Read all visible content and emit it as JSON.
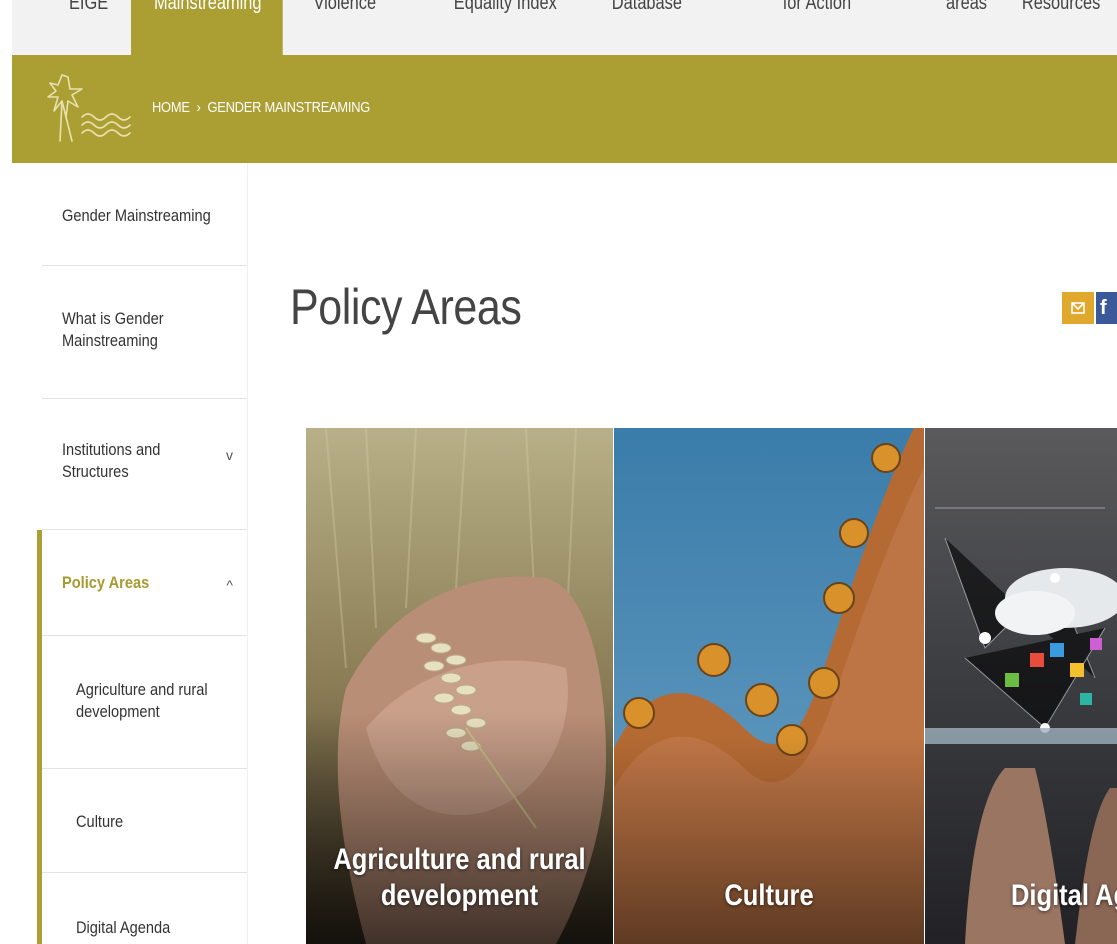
{
  "topnav": {
    "items": [
      {
        "label": "EIGE"
      },
      {
        "label": "Mainstreaming"
      },
      {
        "label": "Violence"
      },
      {
        "label": "Equality Index"
      },
      {
        "label": "Database"
      },
      {
        "label": "for Action"
      },
      {
        "label": "areas"
      },
      {
        "label": "Resources"
      }
    ]
  },
  "breadcrumb": {
    "home": "HOME",
    "separator": "›",
    "current": "GENDER MAINSTREAMING"
  },
  "sidebar": {
    "items": [
      {
        "label": "Gender Mainstreaming"
      },
      {
        "label_line1": "What is Gender",
        "label_line2": "Mainstreaming"
      },
      {
        "label_line1": "Institutions and",
        "label_line2": "Structures",
        "chevron": "v"
      },
      {
        "label": "Policy Areas",
        "chevron": "^"
      },
      {
        "label_line1": "Agriculture and rural",
        "label_line2": "development"
      },
      {
        "label": "Culture"
      },
      {
        "label": "Digital Agenda"
      }
    ]
  },
  "main": {
    "title": "Policy Areas",
    "share": {
      "mail_icon": "mail-icon",
      "facebook_letter": "f"
    },
    "cards": [
      {
        "line1": "Agriculture and rural",
        "line2": "development"
      },
      {
        "line1": "Culture"
      },
      {
        "line1": "Digital Agen"
      }
    ]
  },
  "colors": {
    "brand_olive": "#ab9e33",
    "active_text": "#a79a30",
    "mail_orange": "#e0a92d",
    "facebook_blue": "#3b5998"
  }
}
